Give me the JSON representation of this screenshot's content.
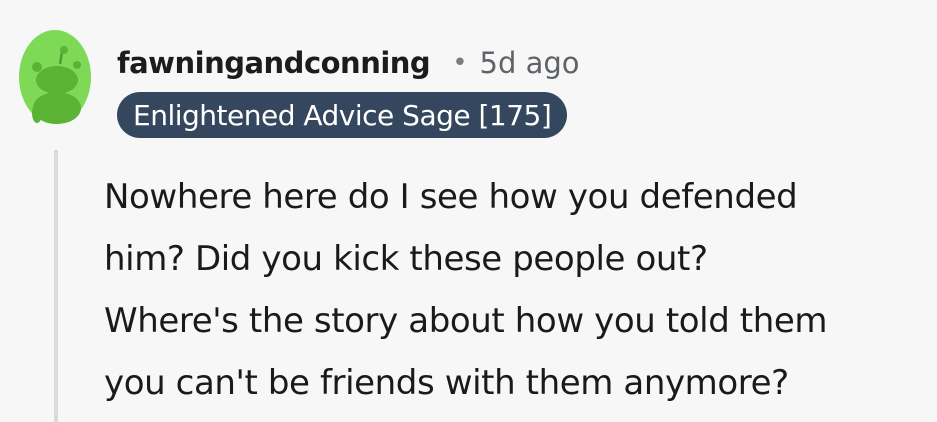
{
  "comment": {
    "username": "fawningandconning",
    "separator": "•",
    "timestamp": "5d ago",
    "flair": "Enlightened Advice Sage [175]",
    "body_lines": [
      "Nowhere here do I see how you defended",
      "him? Did you kick these people out?",
      "Where's the story about how you told them",
      "you can't be friends with them anymore?"
    ],
    "avatar_icon": "snoo-avatar-icon",
    "colors": {
      "avatar_bg": "#7ed957",
      "flair_bg": "#34475e",
      "flair_text": "#ffffff",
      "thread_line": "#d9dcdf"
    }
  }
}
